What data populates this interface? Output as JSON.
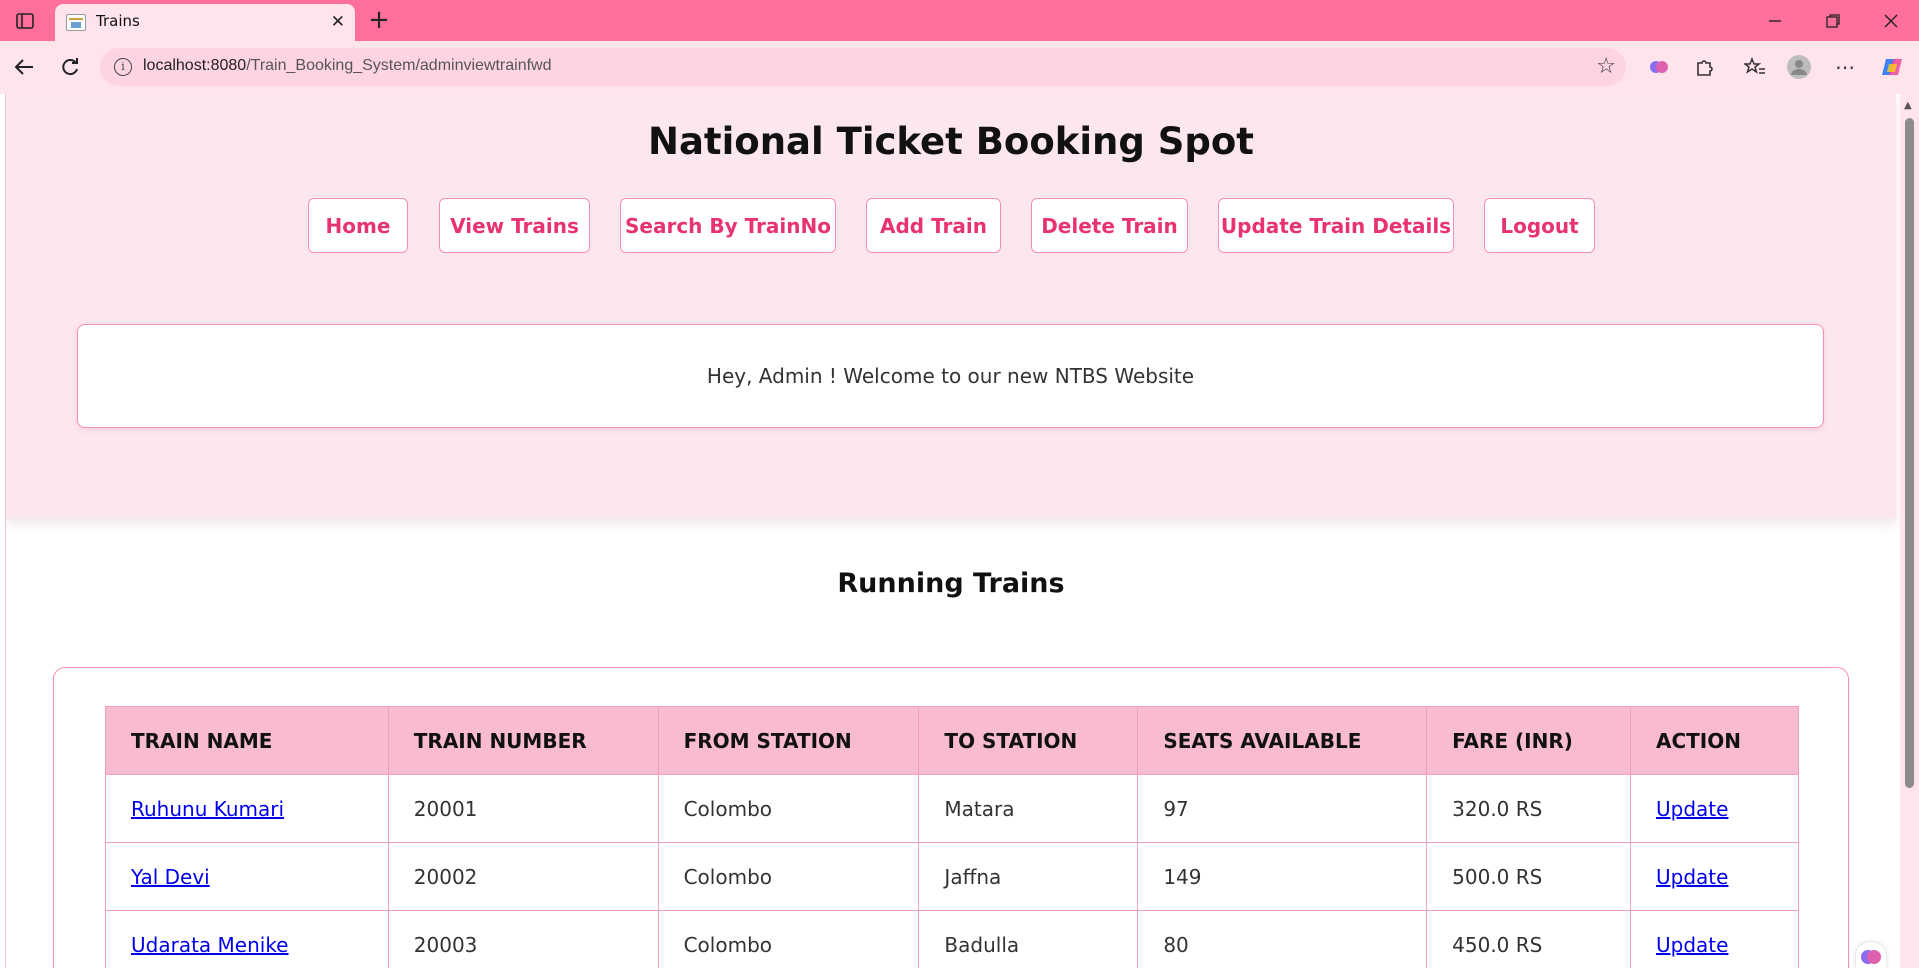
{
  "browser": {
    "tab_title": "Trains",
    "url_host": "localhost:8080",
    "url_path": "/Train_Booking_System/adminviewtrainfwd"
  },
  "site": {
    "title": "National Ticket Booking Spot",
    "nav": [
      "Home",
      "View Trains",
      "Search By TrainNo",
      "Add Train",
      "Delete Train",
      "Update Train Details",
      "Logout"
    ],
    "welcome": "Hey, Admin ! Welcome to our new NTBS Website"
  },
  "section_title": "Running Trains",
  "table": {
    "headers": [
      "TRAIN NAME",
      "TRAIN NUMBER",
      "FROM STATION",
      "TO STATION",
      "SEATS AVAILABLE",
      "FARE (INR)",
      "ACTION"
    ],
    "rows": [
      [
        "Ruhunu Kumari",
        "20001",
        "Colombo",
        "Matara",
        "97",
        "320.0 RS",
        "Update"
      ],
      [
        "Yal Devi",
        "20002",
        "Colombo",
        "Jaffna",
        "149",
        "500.0 RS",
        "Update"
      ],
      [
        "Udarata Menike",
        "20003",
        "Colombo",
        "Badulla",
        "80",
        "450.0 RS",
        "Update"
      ]
    ]
  },
  "colors": {
    "titlebar": "#ff6f9c",
    "accent": "#e8336f",
    "hero_bg": "#fde7ee",
    "table_header": "#f8bbd0"
  }
}
